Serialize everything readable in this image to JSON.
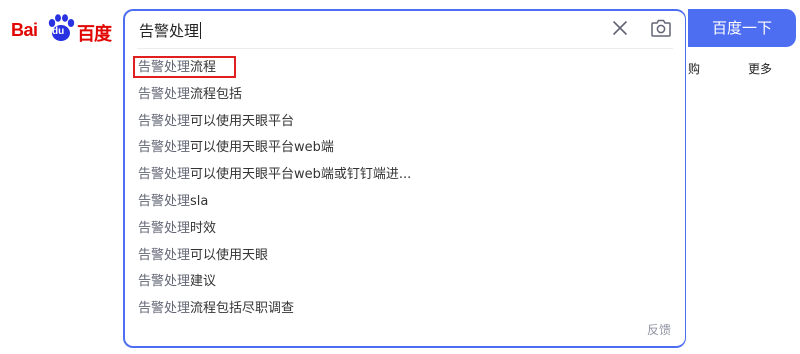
{
  "logo": {
    "text_bai": "Bai",
    "text_du": "du",
    "text_cn": "百度"
  },
  "search": {
    "query": "告警处理",
    "button_label": "百度一下"
  },
  "suggestions": [
    {
      "prefix": "告警处理",
      "rest": "流程"
    },
    {
      "prefix": "告警处理",
      "rest": "流程包括"
    },
    {
      "prefix": "告警处理",
      "rest": "可以使用天眼平台"
    },
    {
      "prefix": "告警处理",
      "rest": "可以使用天眼平台web端"
    },
    {
      "prefix": "告警处理",
      "rest": "可以使用天眼平台web端或钉钉端进..."
    },
    {
      "prefix": "告警处理",
      "rest": "sla"
    },
    {
      "prefix": "告警处理",
      "rest": "时效"
    },
    {
      "prefix": "告警处理",
      "rest": "可以使用天眼"
    },
    {
      "prefix": "告警处理",
      "rest": "建议"
    },
    {
      "prefix": "告警处理",
      "rest": "流程包括尽职调查"
    }
  ],
  "feedback_label": "反馈",
  "nav": {
    "peek_1": "购",
    "peek_2": "更多"
  },
  "colors": {
    "accent": "#4e6ef2",
    "brand_red": "#e10602",
    "highlight_box": "#e02020"
  },
  "icons": {
    "clear": "close-icon",
    "camera": "camera-icon",
    "logo": "baidu-paw-icon"
  }
}
